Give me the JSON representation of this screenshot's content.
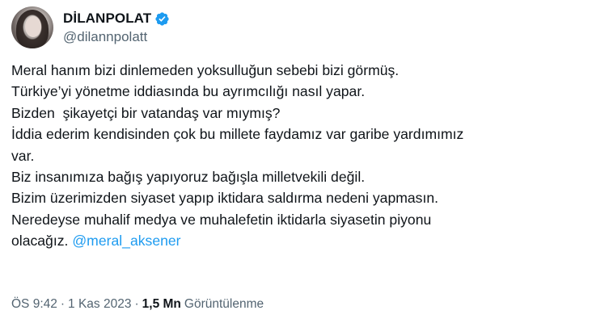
{
  "author": {
    "display_name": "DİLANPOLAT",
    "handle": "@dilannpolatt",
    "verified_color": "#1d9bf0"
  },
  "tweet": {
    "lines": [
      "Meral hanım bizi dinlemeden yoksulluğun sebebi bizi görmüş.",
      "Türkiye’yi yönetme iddiasında bu ayrımcılığı nasıl yapar.",
      "Bizden  şikayetçi bir vatandaş var mıymış?",
      "İddia ederim kendisinden çok bu millete faydamız var garibe yardımımız",
      "var.",
      "Biz insanımıza bağış yapıyoruz bağışla milletvekili değil.",
      "Bizim üzerimizden siyaset yapıp iktidara saldırma nedeni yapmasın.",
      "Neredeyse muhalif medya ve muhalefetin iktidarla siyasetin piyonu"
    ],
    "last_line_text": "olacağız. ",
    "mention": "@meral_aksener"
  },
  "meta": {
    "time": "ÖS 9:42",
    "separator": "·",
    "date": "1 Kas 2023",
    "views_count": "1,5 Mn",
    "views_label": "Görüntülenme"
  },
  "colors": {
    "text": "#0f1419",
    "secondary": "#536471",
    "link": "#1d9bf0",
    "background": "#ffffff"
  }
}
